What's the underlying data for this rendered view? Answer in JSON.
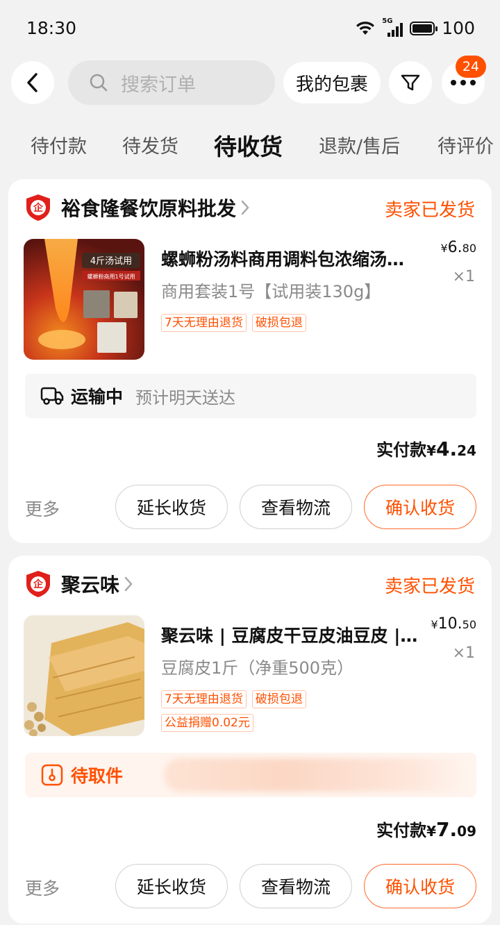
{
  "status_bar": {
    "time": "18:30",
    "network": "5G",
    "battery": "100"
  },
  "nav": {
    "search_placeholder": "搜索订单",
    "package_button": "我的包裹",
    "more_badge": "24"
  },
  "tabs": [
    "待付款",
    "待发货",
    "待收货",
    "退款/售后",
    "待评价"
  ],
  "active_tab": "待收货",
  "colors": {
    "accent": "#ff5000",
    "background": "#f2f2f2",
    "card": "#ffffff"
  },
  "orders": [
    {
      "shop_name": "裕食隆餐饮原料批发",
      "shop_icon": "enterprise-shield-icon",
      "status": "卖家已发货",
      "product": {
        "title": "螺蛳粉汤料商用调料包浓缩汤…",
        "spec": "商用套装1号【试用装130g】",
        "tags": [
          "7天无理由退货",
          "破损包退"
        ],
        "price_symbol": "¥",
        "price_int": "6.",
        "price_dec": "80",
        "quantity": "×1",
        "image_caption": "4斤汤试用",
        "image_sub": "螺蛳粉商用1号试用"
      },
      "logistics": {
        "status": "运输中",
        "desc": "预计明天送达",
        "icon": "truck-icon"
      },
      "paid_label": "实付款",
      "paid_symbol": "¥",
      "paid_int": "4.",
      "paid_dec": "24",
      "more": "更多",
      "buttons": {
        "extend": "延长收货",
        "track": "查看物流",
        "confirm": "确认收货"
      }
    },
    {
      "shop_name": "聚云味",
      "shop_icon": "enterprise-shield-icon",
      "status": "卖家已发货",
      "product": {
        "title": "聚云味 | 豆腐皮干豆皮油豆皮 |…",
        "spec": "豆腐皮1斤（净重500克）",
        "tags": [
          "7天无理由退货",
          "破损包退",
          "公益捐赠0.02元"
        ],
        "price_symbol": "¥",
        "price_int": "10.",
        "price_dec": "50",
        "quantity": "×1"
      },
      "logistics": {
        "status": "待取件",
        "desc": "",
        "icon": "pickup-locker-icon"
      },
      "paid_label": "实付款",
      "paid_symbol": "¥",
      "paid_int": "7.",
      "paid_dec": "09",
      "more": "更多",
      "buttons": {
        "extend": "延长收货",
        "track": "查看物流",
        "confirm": "确认收货"
      }
    }
  ]
}
